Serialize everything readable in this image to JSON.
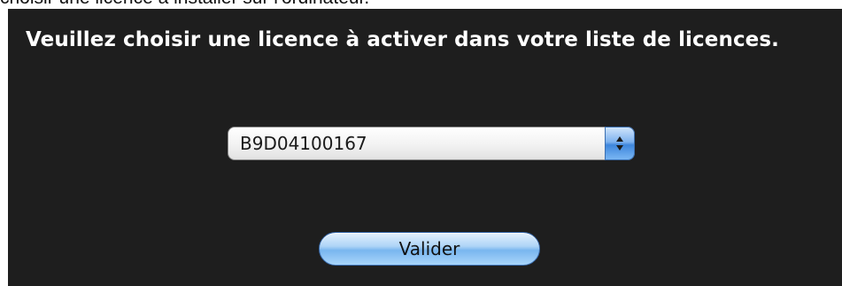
{
  "page": {
    "top_caption": "choisir une licence à installer sur l'ordinateur."
  },
  "dialog": {
    "prompt": "Veuillez choisir une licence à activer dans votre liste de licences.",
    "license_select": {
      "selected_value": "B9D04100167",
      "icon": "up-down-stepper-icon"
    },
    "validate_label": "Valider"
  },
  "colors": {
    "panel_background": "#1e1e1e",
    "prompt_text": "#ffffff",
    "aqua_blue": "#79b6ef"
  }
}
